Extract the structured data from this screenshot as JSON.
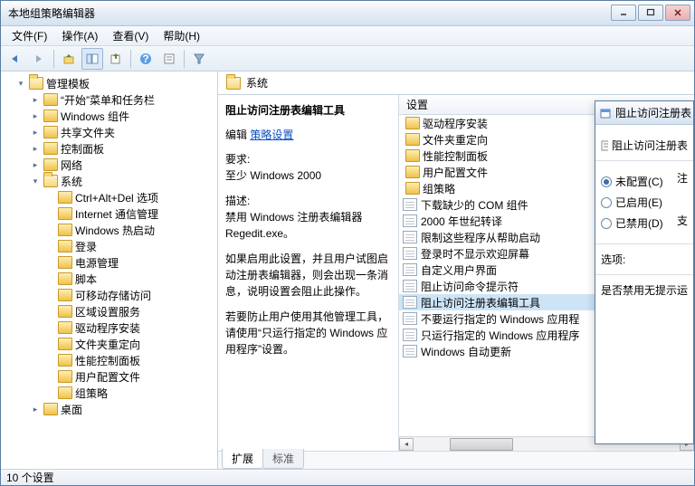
{
  "window": {
    "title": "本地组策略编辑器"
  },
  "menu": {
    "file": "文件(F)",
    "action": "操作(A)",
    "view": "查看(V)",
    "help": "帮助(H)"
  },
  "tree": {
    "root": "管理模板",
    "items": [
      "“开始”菜单和任务栏",
      "Windows 组件",
      "共享文件夹",
      "控制面板",
      "网络",
      "系统"
    ],
    "system_children": [
      "Ctrl+Alt+Del 选项",
      "Internet 通信管理",
      "Windows 热启动",
      "登录",
      "电源管理",
      "脚本",
      "可移动存储访问",
      "区域设置服务",
      "驱动程序安装",
      "文件夹重定向",
      "性能控制面板",
      "用户配置文件",
      "组策略"
    ],
    "last": "桌面"
  },
  "breadcrumb": "系统",
  "desc": {
    "title": "阻止访问注册表编辑工具",
    "edit_label": "编辑",
    "edit_link": "策略设置",
    "req_label": "要求:",
    "req_value": "至少 Windows 2000",
    "desc_label": "描述:",
    "p1": "禁用 Windows 注册表编辑器 Regedit.exe。",
    "p2": "如果启用此设置，并且用户试图启动注册表编辑器，则会出现一条消息，说明设置会阻止此操作。",
    "p3": "若要防止用户使用其他管理工具，请使用“只运行指定的 Windows 应用程序”设置。"
  },
  "list": {
    "header": "设置",
    "items": [
      {
        "icon": "folder",
        "label": "驱动程序安装"
      },
      {
        "icon": "folder",
        "label": "文件夹重定向"
      },
      {
        "icon": "folder",
        "label": "性能控制面板"
      },
      {
        "icon": "folder",
        "label": "用户配置文件"
      },
      {
        "icon": "folder",
        "label": "组策略"
      },
      {
        "icon": "file",
        "label": "下载缺少的 COM 组件"
      },
      {
        "icon": "file",
        "label": "2000 年世纪转译"
      },
      {
        "icon": "file",
        "label": "限制这些程序从帮助启动"
      },
      {
        "icon": "file",
        "label": "登录时不显示欢迎屏幕"
      },
      {
        "icon": "file",
        "label": "自定义用户界面"
      },
      {
        "icon": "file",
        "label": "阻止访问命令提示符"
      },
      {
        "icon": "file",
        "label": "阻止访问注册表编辑工具",
        "selected": true
      },
      {
        "icon": "file",
        "label": "不要运行指定的 Windows 应用程"
      },
      {
        "icon": "file",
        "label": "只运行指定的 Windows 应用程序"
      },
      {
        "icon": "file",
        "label": "Windows 自动更新"
      }
    ]
  },
  "tabs": {
    "extended": "扩展",
    "standard": "标准"
  },
  "status": "10 个设置",
  "dialog": {
    "title": "阻止访问注册表",
    "subtitle": "阻止访问注册表",
    "opt_unconfigured": "未配置(C)",
    "opt_enabled": "已启用(E)",
    "opt_disabled": "已禁用(D)",
    "side_note": "注",
    "side_support": "支",
    "options_label": "选项:",
    "content": "是否禁用无提示运"
  }
}
